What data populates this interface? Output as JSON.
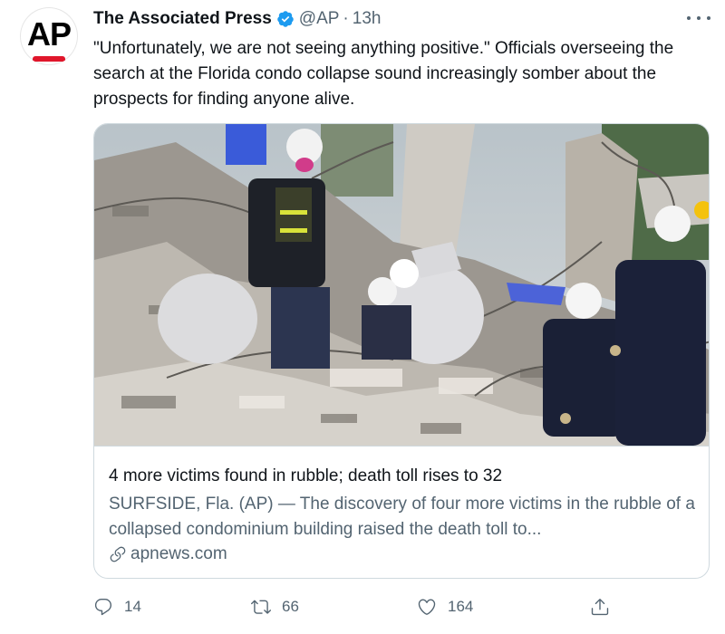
{
  "tweet": {
    "avatar_logo": "AP",
    "display_name": "The Associated Press",
    "handle": "@AP",
    "separator": "·",
    "time": "13h",
    "text": "\"Unfortunately, we are not seeing anything positive.\" Officials overseeing the search at the Florida condo collapse sound increasingly somber about the prospects for finding anyone alive."
  },
  "card": {
    "title": "4 more victims found in rubble; death toll rises to 32",
    "description": "SURFSIDE, Fla. (AP) — The discovery of four more victims in the rubble of a collapsed condominium building raised the death toll to...",
    "domain": "apnews.com"
  },
  "actions": {
    "reply_count": "14",
    "retweet_count": "66",
    "like_count": "164"
  },
  "colors": {
    "text_primary": "#0f1419",
    "text_secondary": "#536471",
    "border": "#cfd9de",
    "verified_blue": "#1d9bf0",
    "ap_red": "#e0162b"
  },
  "icons": [
    "ap-logo",
    "verified-badge-icon",
    "more-options-icon",
    "link-icon",
    "reply-icon",
    "retweet-icon",
    "like-icon",
    "share-icon"
  ]
}
